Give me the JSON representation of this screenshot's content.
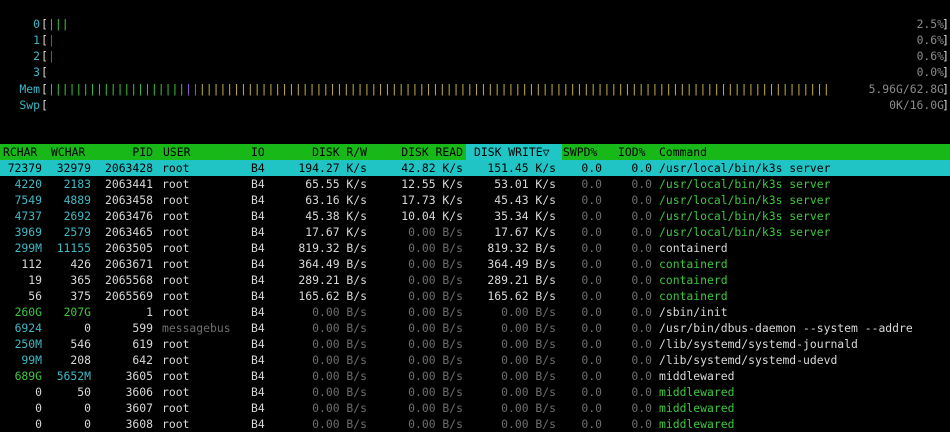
{
  "meters": [
    {
      "label": "0",
      "bar": "|||",
      "bar_color": "#3ec63e",
      "value": "2.5%",
      "level": 0.025
    },
    {
      "label": "1",
      "bar": "|",
      "bar_color": "#d23a3a",
      "value": "0.6%",
      "level": 0.006
    },
    {
      "label": "2",
      "bar": "|",
      "bar_color": "#d23a3a",
      "value": "0.6%",
      "level": 0.006
    },
    {
      "label": "3",
      "bar": "",
      "bar_color": "#3ec63e",
      "value": "0.0%",
      "level": 0.0
    },
    {
      "label": "Mem",
      "bar": "||||||||||||||||||||||||||||||||||||||||||||||||||||||||||||||||||||||||||||||||",
      "bar_color": "#3ec63e",
      "value": "5.96G/62.8G",
      "level": 0.0949
    },
    {
      "label": "Swp",
      "bar": "",
      "bar_color": "#d23a3a",
      "value": "0K/16.0G",
      "level": 0.0
    }
  ],
  "mem_bar_parts": [
    {
      "text": "||||||||||||||||||||",
      "color": "#3ec63e"
    },
    {
      "text": "||",
      "color": "#8a5fd0"
    },
    {
      "text": "||||||||||||||||||||||||||||||||||||||||||||||||||||||||||||||||||||||||||||||||||||||||||||",
      "color": "#c7b43b"
    }
  ],
  "columns": {
    "rchar": "RCHAR",
    "wchar": "WCHAR",
    "pid": "PID",
    "user": "USER",
    "io": "IO",
    "disk": "DISK R/W",
    "read": "DISK READ",
    "write": "DISK WRITE▽",
    "swpd": "SWPD%",
    "iod": "IOD%",
    "cmd": "Command"
  },
  "rows": [
    {
      "rchar": "72379",
      "wchar": "32979",
      "pid": "2063428",
      "user": "root",
      "io": "B4",
      "disk": "194.27 K/s",
      "read": "42.82 K/s",
      "write": "151.45 K/s",
      "swpd": "0.0",
      "iod": "0.0",
      "cmd": "/usr/local/bin/k3s server",
      "cmd_color": "green",
      "user_color": "white",
      "rchar_color": "cyan",
      "wchar_color": "cyan",
      "readz": false,
      "writez": false,
      "diskz": false
    },
    {
      "rchar": "4220",
      "wchar": "2183",
      "pid": "2063441",
      "user": "root",
      "io": "B4",
      "disk": "65.55 K/s",
      "read": "12.55 K/s",
      "write": "53.01 K/s",
      "swpd": "0.0",
      "iod": "0.0",
      "cmd": "/usr/local/bin/k3s server",
      "cmd_color": "green",
      "user_color": "white",
      "rchar_color": "cyan",
      "wchar_color": "cyan",
      "readz": false,
      "writez": false,
      "diskz": false
    },
    {
      "rchar": "7549",
      "wchar": "4889",
      "pid": "2063458",
      "user": "root",
      "io": "B4",
      "disk": "63.16 K/s",
      "read": "17.73 K/s",
      "write": "45.43 K/s",
      "swpd": "0.0",
      "iod": "0.0",
      "cmd": "/usr/local/bin/k3s server",
      "cmd_color": "green",
      "user_color": "white",
      "rchar_color": "cyan",
      "wchar_color": "cyan",
      "readz": false,
      "writez": false,
      "diskz": false
    },
    {
      "rchar": "4737",
      "wchar": "2692",
      "pid": "2063476",
      "user": "root",
      "io": "B4",
      "disk": "45.38 K/s",
      "read": "10.04 K/s",
      "write": "35.34 K/s",
      "swpd": "0.0",
      "iod": "0.0",
      "cmd": "/usr/local/bin/k3s server",
      "cmd_color": "green",
      "user_color": "white",
      "rchar_color": "cyan",
      "wchar_color": "cyan",
      "readz": false,
      "writez": false,
      "diskz": false
    },
    {
      "rchar": "3969",
      "wchar": "2579",
      "pid": "2063465",
      "user": "root",
      "io": "B4",
      "disk": "17.67 K/s",
      "read": "0.00 B/s",
      "write": "17.67 K/s",
      "swpd": "0.0",
      "iod": "0.0",
      "cmd": "/usr/local/bin/k3s server",
      "cmd_color": "green",
      "user_color": "white",
      "rchar_color": "cyan",
      "wchar_color": "cyan",
      "readz": true,
      "writez": false,
      "diskz": false
    },
    {
      "rchar": "299M",
      "wchar": "11155",
      "pid": "2063505",
      "user": "root",
      "io": "B4",
      "disk": "819.32 B/s",
      "read": "0.00 B/s",
      "write": "819.32 B/s",
      "swpd": "0.0",
      "iod": "0.0",
      "cmd": "containerd",
      "cmd_color": "white",
      "user_color": "white",
      "rchar_color": "cyan",
      "wchar_color": "cyan",
      "readz": true,
      "writez": false,
      "diskz": false
    },
    {
      "rchar": "112",
      "wchar": "426",
      "pid": "2063671",
      "user": "root",
      "io": "B4",
      "disk": "364.49 B/s",
      "read": "0.00 B/s",
      "write": "364.49 B/s",
      "swpd": "0.0",
      "iod": "0.0",
      "cmd": "containerd",
      "cmd_color": "green",
      "user_color": "white",
      "rchar_color": "white",
      "wchar_color": "white",
      "readz": true,
      "writez": false,
      "diskz": false
    },
    {
      "rchar": "19",
      "wchar": "365",
      "pid": "2065568",
      "user": "root",
      "io": "B4",
      "disk": "289.21 B/s",
      "read": "0.00 B/s",
      "write": "289.21 B/s",
      "swpd": "0.0",
      "iod": "0.0",
      "cmd": "containerd",
      "cmd_color": "green",
      "user_color": "white",
      "rchar_color": "white",
      "wchar_color": "white",
      "readz": true,
      "writez": false,
      "diskz": false
    },
    {
      "rchar": "56",
      "wchar": "375",
      "pid": "2065569",
      "user": "root",
      "io": "B4",
      "disk": "165.62 B/s",
      "read": "0.00 B/s",
      "write": "165.62 B/s",
      "swpd": "0.0",
      "iod": "0.0",
      "cmd": "containerd",
      "cmd_color": "green",
      "user_color": "white",
      "rchar_color": "white",
      "wchar_color": "white",
      "readz": true,
      "writez": false,
      "diskz": false
    },
    {
      "rchar": "260G",
      "wchar": "207G",
      "pid": "1",
      "user": "root",
      "io": "B4",
      "disk": "0.00 B/s",
      "read": "0.00 B/s",
      "write": "0.00 B/s",
      "swpd": "0.0",
      "iod": "0.0",
      "cmd": "/sbin/init",
      "cmd_color": "white",
      "user_color": "white",
      "rchar_color": "green",
      "wchar_color": "green",
      "readz": true,
      "writez": true,
      "diskz": true
    },
    {
      "rchar": "6924",
      "wchar": "0",
      "pid": "599",
      "user": "messagebus",
      "io": "B4",
      "disk": "0.00 B/s",
      "read": "0.00 B/s",
      "write": "0.00 B/s",
      "swpd": "0.0",
      "iod": "0.0",
      "cmd": "/usr/bin/dbus-daemon --system --addre",
      "cmd_color": "white",
      "user_color": "gray",
      "rchar_color": "cyan",
      "wchar_color": "white",
      "readz": true,
      "writez": true,
      "diskz": true
    },
    {
      "rchar": "250M",
      "wchar": "546",
      "pid": "619",
      "user": "root",
      "io": "B4",
      "disk": "0.00 B/s",
      "read": "0.00 B/s",
      "write": "0.00 B/s",
      "swpd": "0.0",
      "iod": "0.0",
      "cmd": "/lib/systemd/systemd-journald",
      "cmd_color": "white",
      "user_color": "white",
      "rchar_color": "cyan",
      "wchar_color": "white",
      "readz": true,
      "writez": true,
      "diskz": true
    },
    {
      "rchar": "99M",
      "wchar": "208",
      "pid": "642",
      "user": "root",
      "io": "B4",
      "disk": "0.00 B/s",
      "read": "0.00 B/s",
      "write": "0.00 B/s",
      "swpd": "0.0",
      "iod": "0.0",
      "cmd": "/lib/systemd/systemd-udevd",
      "cmd_color": "white",
      "user_color": "white",
      "rchar_color": "cyan",
      "wchar_color": "white",
      "readz": true,
      "writez": true,
      "diskz": true
    },
    {
      "rchar": "689G",
      "wchar": "5652M",
      "pid": "3605",
      "user": "root",
      "io": "B4",
      "disk": "0.00 B/s",
      "read": "0.00 B/s",
      "write": "0.00 B/s",
      "swpd": "0.0",
      "iod": "0.0",
      "cmd": "middlewared",
      "cmd_color": "white",
      "user_color": "white",
      "rchar_color": "green",
      "wchar_color": "cyan",
      "readz": true,
      "writez": true,
      "diskz": true
    },
    {
      "rchar": "0",
      "wchar": "50",
      "pid": "3606",
      "user": "root",
      "io": "B4",
      "disk": "0.00 B/s",
      "read": "0.00 B/s",
      "write": "0.00 B/s",
      "swpd": "0.0",
      "iod": "0.0",
      "cmd": "middlewared",
      "cmd_color": "green",
      "user_color": "white",
      "rchar_color": "white",
      "wchar_color": "white",
      "readz": true,
      "writez": true,
      "diskz": true
    },
    {
      "rchar": "0",
      "wchar": "0",
      "pid": "3607",
      "user": "root",
      "io": "B4",
      "disk": "0.00 B/s",
      "read": "0.00 B/s",
      "write": "0.00 B/s",
      "swpd": "0.0",
      "iod": "0.0",
      "cmd": "middlewared",
      "cmd_color": "green",
      "user_color": "white",
      "rchar_color": "white",
      "wchar_color": "white",
      "readz": true,
      "writez": true,
      "diskz": true
    },
    {
      "rchar": "0",
      "wchar": "0",
      "pid": "3608",
      "user": "root",
      "io": "B4",
      "disk": "0.00 B/s",
      "read": "0.00 B/s",
      "write": "0.00 B/s",
      "swpd": "0.0",
      "iod": "0.0",
      "cmd": "middlewared",
      "cmd_color": "green",
      "user_color": "white",
      "rchar_color": "white",
      "wchar_color": "white",
      "readz": true,
      "writez": true,
      "diskz": true
    }
  ],
  "selected_row": 0
}
